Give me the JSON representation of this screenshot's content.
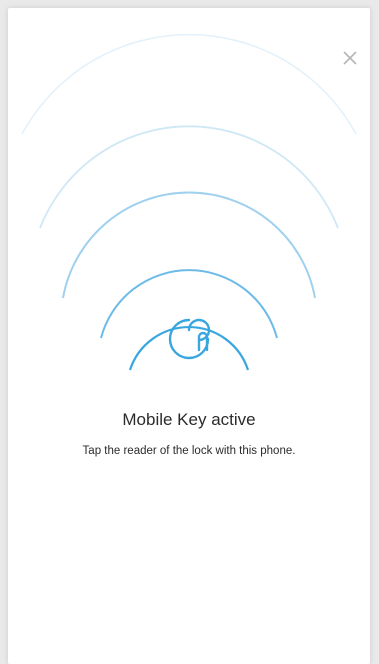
{
  "dialog": {
    "close_icon": "close-icon",
    "status_icon": "touch-finger-icon",
    "title": "Mobile Key active",
    "subtitle": "Tap the reader of the lock with this phone."
  },
  "colors": {
    "accent": "#3aa6e0",
    "wave_light": "#cfe8f6",
    "text": "#2b2b2b",
    "close": "#b5b5b5"
  }
}
